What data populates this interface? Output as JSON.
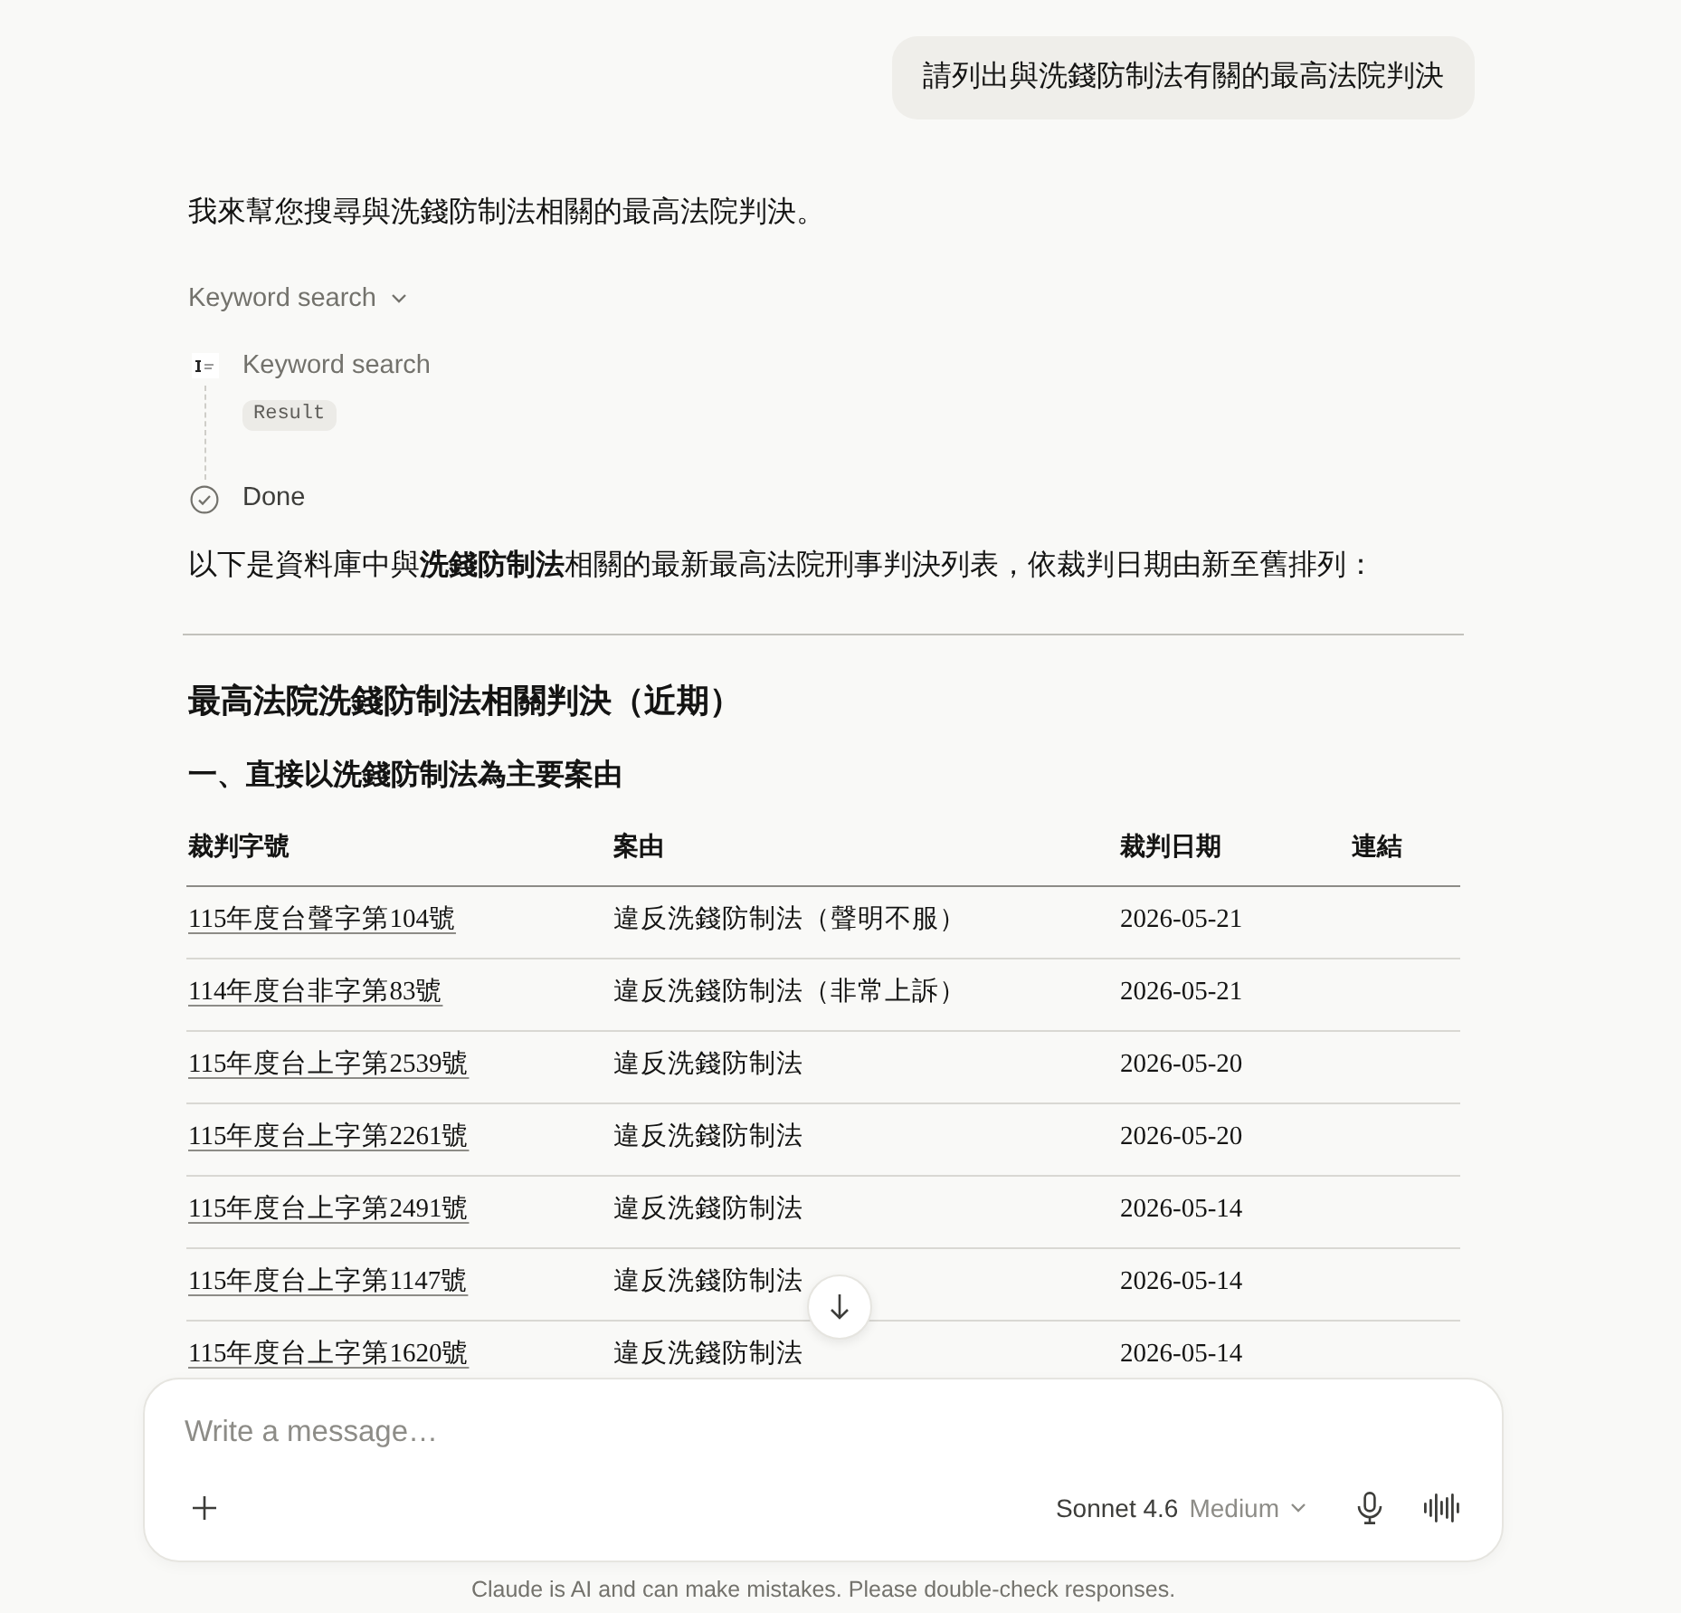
{
  "user_message": {
    "text": "請列出與洗錢防制法有關的最高法院判決"
  },
  "assistant": {
    "intro": "我來幫您搜尋與洗錢防制法相關的最高法院判決。",
    "tool_group": {
      "label": "Keyword search",
      "expanded": true,
      "steps": [
        {
          "kind": "tool",
          "title": "Keyword search",
          "badge": "Result"
        },
        {
          "kind": "done",
          "title": "Done"
        }
      ]
    },
    "summary": "以下是資料庫中與**洗錢防制法**相關的最新最高法院刑事判決列表，依裁判日期由新至舊排列：",
    "heading": "最高法院洗錢防制法相關判決（近期）",
    "subheading": "一、直接以洗錢防制法為主要案由",
    "table": {
      "columns": [
        "裁判字號",
        "案由",
        "裁判日期",
        "連結"
      ],
      "rows": [
        [
          "115年度台聲字第104號",
          "違反洗錢防制法（聲明不服）",
          "2026-05-21"
        ],
        [
          "114年度台非字第83號",
          "違反洗錢防制法（非常上訴）",
          "2026-05-21"
        ],
        [
          "115年度台上字第2539號",
          "違反洗錢防制法",
          "2026-05-20"
        ],
        [
          "115年度台上字第2261號",
          "違反洗錢防制法",
          "2026-05-20"
        ],
        [
          "115年度台上字第2491號",
          "違反洗錢防制法",
          "2026-05-14"
        ],
        [
          "115年度台上字第1147號",
          "違反洗錢防制法",
          "2026-05-14"
        ],
        [
          "115年度台上字第1620號",
          "違反洗錢防制法",
          "2026-05-14"
        ]
      ]
    }
  },
  "composer": {
    "placeholder": "Write a message…",
    "model": "Sonnet 4.6",
    "effort": "Medium"
  },
  "disclaimer": "Claude is AI and can make mistakes. Please double-check responses."
}
